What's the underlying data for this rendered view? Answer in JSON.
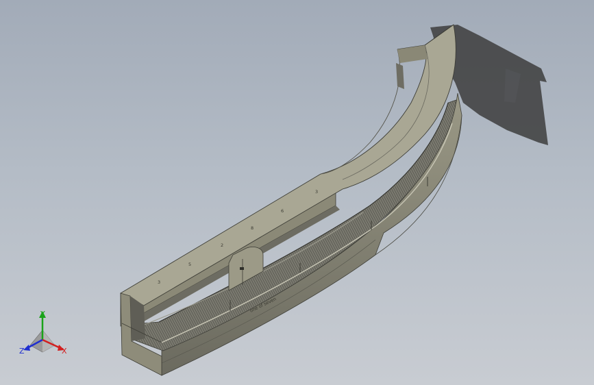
{
  "viewport": {
    "background_top": "#a2abb8",
    "background_bottom": "#c8ccd2"
  },
  "model": {
    "body_color": "#8f8d7d",
    "top_color": "#a8a694",
    "floor_color": "#6f6e66",
    "shadow_color": "#3c3c3c",
    "engraving": "one of seven",
    "rib_numbers": [
      "3",
      "5",
      "2",
      "8",
      "6",
      "3"
    ]
  },
  "triad": {
    "x_label": "X",
    "y_label": "Y",
    "z_label": "Z",
    "x_color": "#d22020",
    "y_color": "#1aa31a",
    "z_color": "#1f2fd0"
  }
}
